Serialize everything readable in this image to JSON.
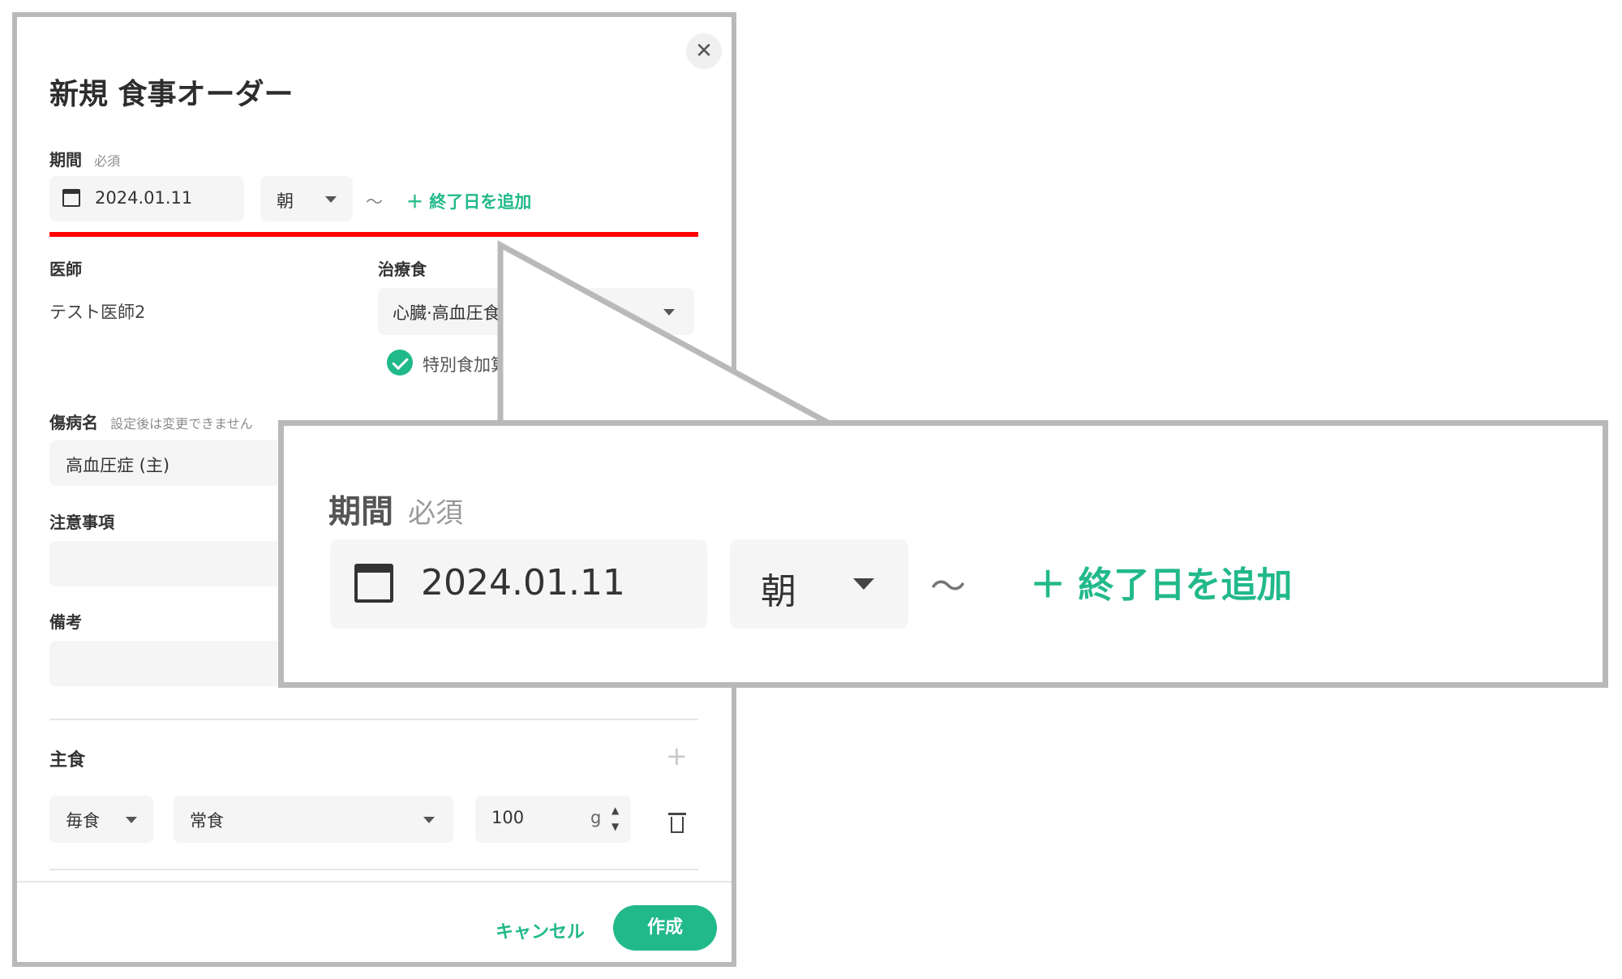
{
  "dialog": {
    "title": "新規 食事オーダー",
    "close_icon": "close-icon",
    "period": {
      "label": "期間",
      "required": "必須",
      "date_value": "2024.01.11",
      "meal_value": "朝",
      "tilde": "〜",
      "add_end_date": "＋ 終了日を追加"
    },
    "doctor": {
      "label": "医師",
      "value": "テスト医師2"
    },
    "therapeutic_diet": {
      "label": "治療食",
      "value": "心臓·高血圧食",
      "special_addition": "特別食加算"
    },
    "disease": {
      "label": "傷病名",
      "note": "設定後は変更できません",
      "value": "高血圧症 (主)"
    },
    "precautions": {
      "label": "注意事項",
      "value": ""
    },
    "remarks": {
      "label": "備考",
      "value": ""
    },
    "staple": {
      "label": "主食",
      "frequency": "毎食",
      "type": "常食",
      "amount": "100",
      "unit": "g"
    },
    "footer": {
      "cancel_label": "キャンセル",
      "create_label": "作成"
    }
  },
  "colors": {
    "accent": "#22b98a",
    "highlight_line": "#ff0000",
    "frame": "#b9b9b9",
    "field_bg": "#f5f5f5"
  }
}
